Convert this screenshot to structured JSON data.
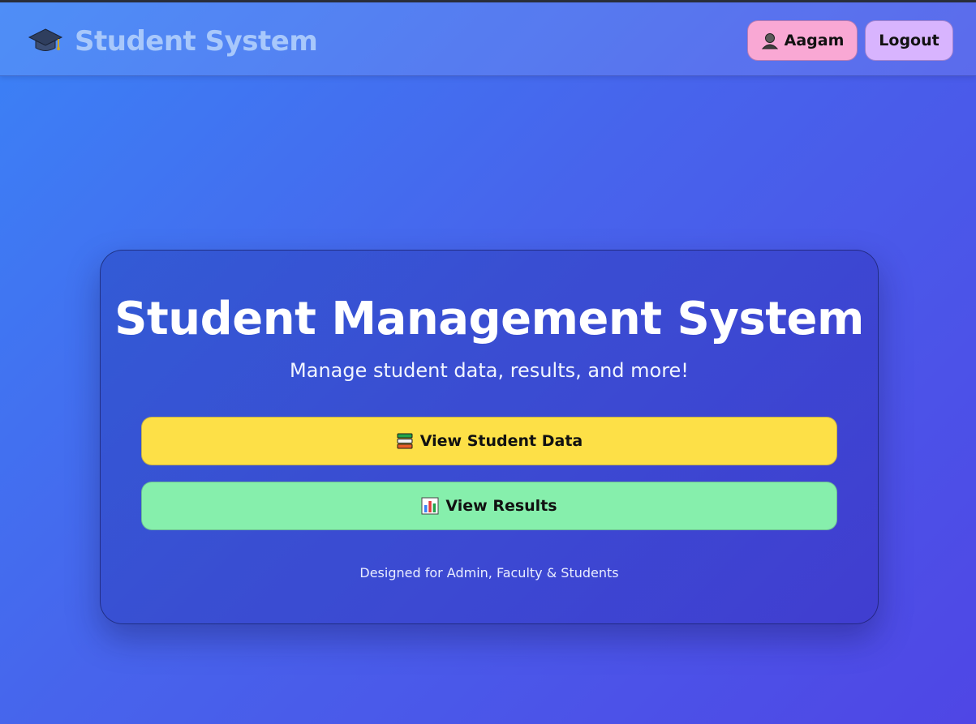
{
  "navbar": {
    "brand_icon": "graduation-cap-icon",
    "brand_title": "Student System",
    "user": {
      "icon": "user-avatar-icon",
      "name": "Aagam"
    },
    "logout_label": "Logout"
  },
  "hero": {
    "title": "Student Management System",
    "subtitle": "Manage student data, results, and more!",
    "buttons": [
      {
        "icon": "books-icon",
        "label": "View Student Data",
        "color": "#fde047"
      },
      {
        "icon": "bar-chart-icon",
        "label": "View Results",
        "color": "#86efac"
      }
    ],
    "footer": "Designed for Admin, Faculty & Students"
  },
  "colors": {
    "background_start": "#3b82f6",
    "background_end": "#4f46e5",
    "user_button": "#f9a8d4",
    "logout_button": "#d8b4fe"
  }
}
